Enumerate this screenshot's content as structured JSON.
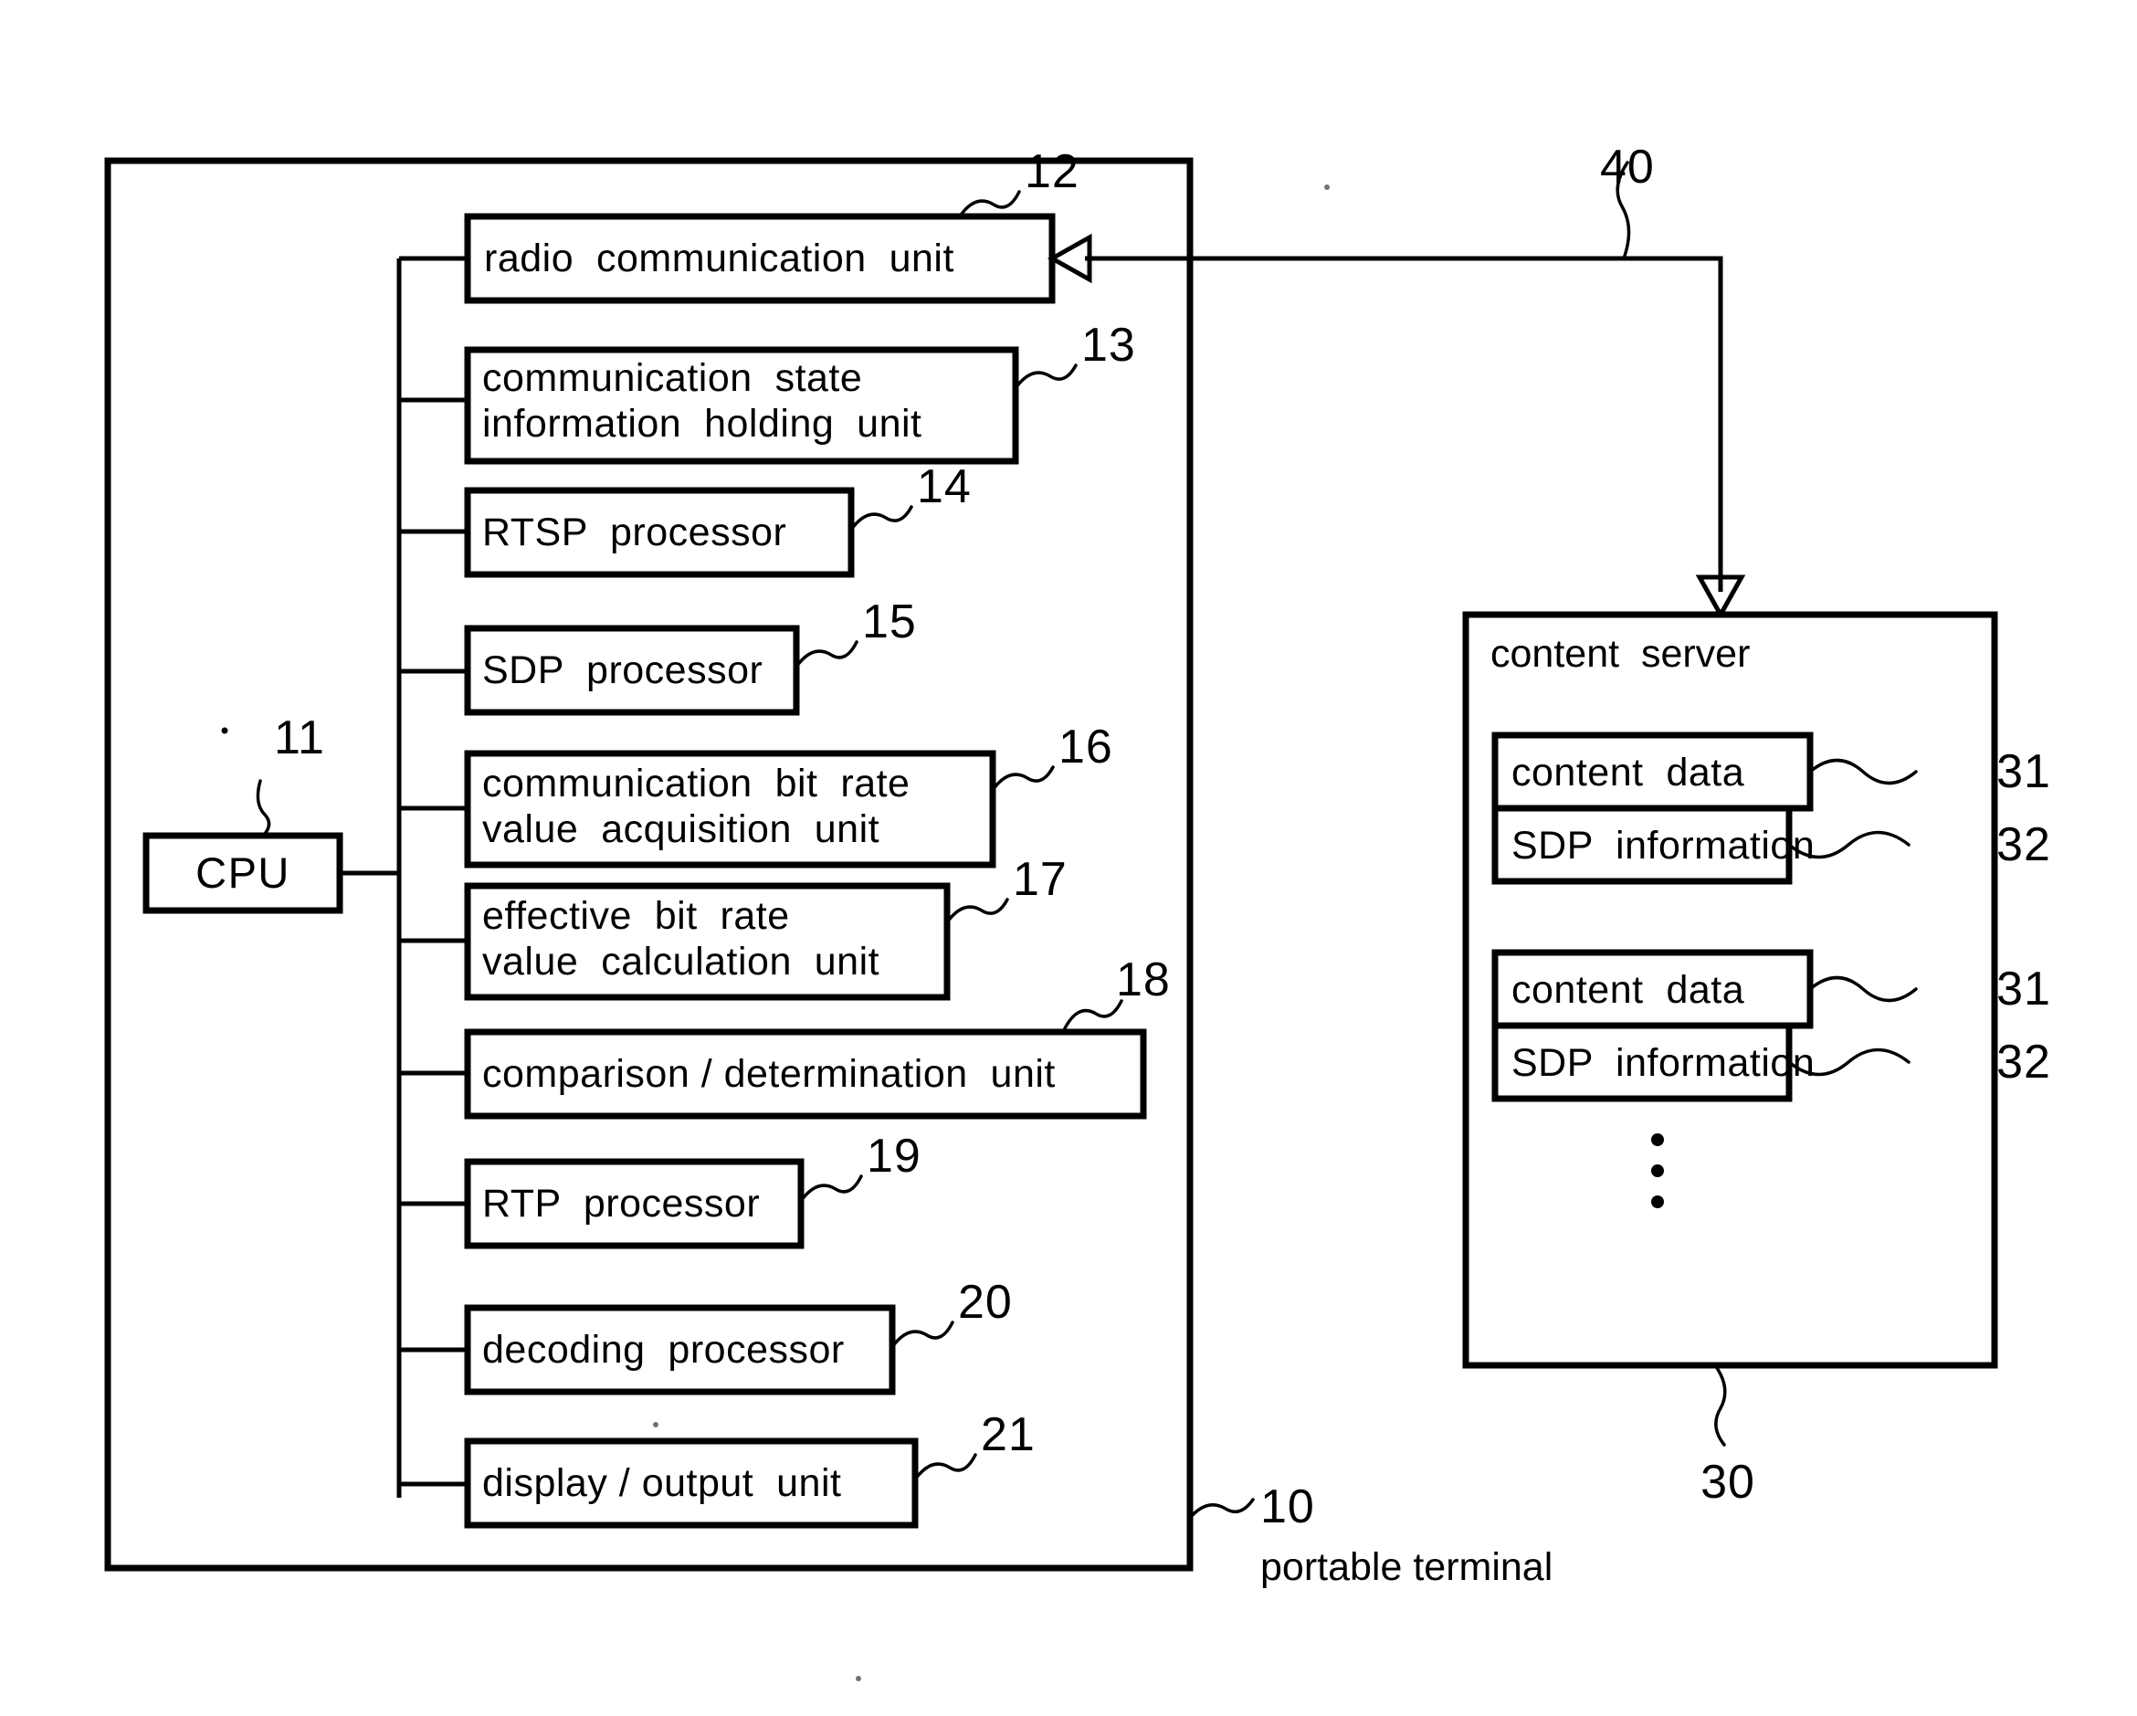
{
  "figure": {
    "type": "patent-block-diagram",
    "background_color": "#ffffff",
    "line_color": "#000000"
  },
  "terminal": {
    "ref": "10",
    "caption": "portable terminal",
    "cpu": {
      "label": "CPU",
      "ref": "11"
    },
    "modules": [
      {
        "ref": "12",
        "lines": [
          "radio  communication  unit"
        ]
      },
      {
        "ref": "13",
        "lines": [
          "communication  state",
          "information  holding  unit"
        ]
      },
      {
        "ref": "14",
        "lines": [
          "RTSP  processor"
        ]
      },
      {
        "ref": "15",
        "lines": [
          "SDP  processor"
        ]
      },
      {
        "ref": "16",
        "lines": [
          "communication  bit  rate",
          "value  acquisition  unit"
        ]
      },
      {
        "ref": "17",
        "lines": [
          "effective  bit  rate",
          "value  calculation  unit"
        ]
      },
      {
        "ref": "18",
        "lines": [
          "comparison / determination  unit"
        ]
      },
      {
        "ref": "19",
        "lines": [
          "RTP  processor"
        ]
      },
      {
        "ref": "20",
        "lines": [
          "decoding  processor"
        ]
      },
      {
        "ref": "21",
        "lines": [
          "display / output  unit"
        ]
      }
    ]
  },
  "server": {
    "ref": "30",
    "title": "content  server",
    "entries": [
      {
        "content_label": "content  data",
        "content_ref": "31",
        "sdp_label": "SDP  information",
        "sdp_ref": "32"
      },
      {
        "content_label": "content  data",
        "content_ref": "31",
        "sdp_label": "SDP  information",
        "sdp_ref": "32"
      }
    ],
    "continuation_marker": "vertical-ellipsis"
  },
  "network_link": {
    "ref": "40",
    "direction": "server-to-radio-unit",
    "arrowheads": [
      "open-triangle-left",
      "open-triangle-down"
    ]
  }
}
